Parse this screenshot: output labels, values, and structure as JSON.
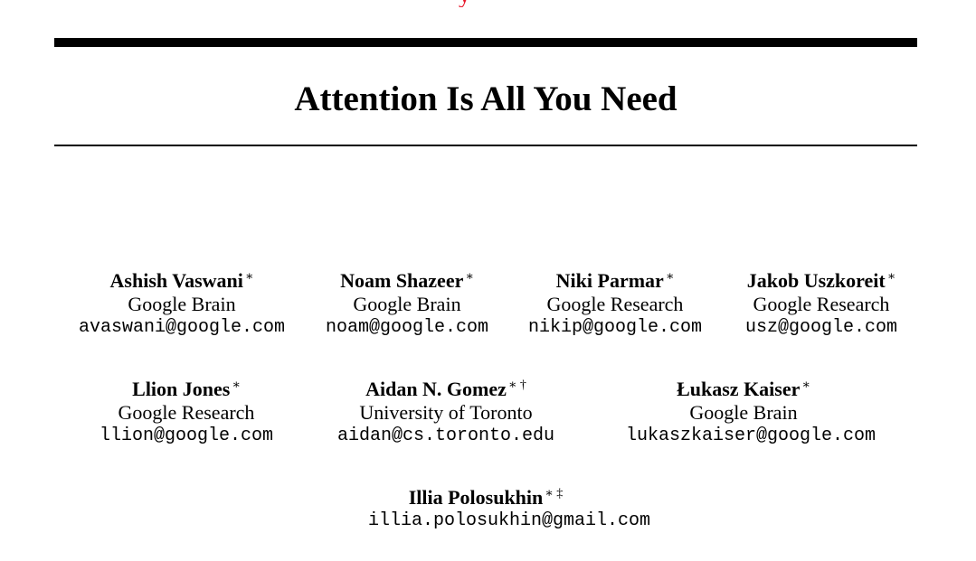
{
  "header": {
    "top_fragment": "y"
  },
  "title": "Attention Is All You Need",
  "authors": [
    {
      "name": "Ashish Vaswani",
      "mark": "∗",
      "affiliation": "Google Brain",
      "email": "avaswani@google.com"
    },
    {
      "name": "Noam Shazeer",
      "mark": "∗",
      "affiliation": "Google Brain",
      "email": "noam@google.com"
    },
    {
      "name": "Niki Parmar",
      "mark": "∗",
      "affiliation": "Google Research",
      "email": "nikip@google.com"
    },
    {
      "name": "Jakob Uszkoreit",
      "mark": "∗",
      "affiliation": "Google Research",
      "email": "usz@google.com"
    },
    {
      "name": "Llion Jones",
      "mark": "∗",
      "affiliation": "Google Research",
      "email": "llion@google.com"
    },
    {
      "name": "Aidan N. Gomez",
      "mark": "∗ †",
      "affiliation": "University of Toronto",
      "email": "aidan@cs.toronto.edu"
    },
    {
      "name": "Łukasz Kaiser",
      "mark": "∗",
      "affiliation": "Google Brain",
      "email": "lukaszkaiser@google.com"
    },
    {
      "name": "Illia Polosukhin",
      "mark": "∗ ‡",
      "email": "illia.polosukhin@gmail.com"
    }
  ]
}
